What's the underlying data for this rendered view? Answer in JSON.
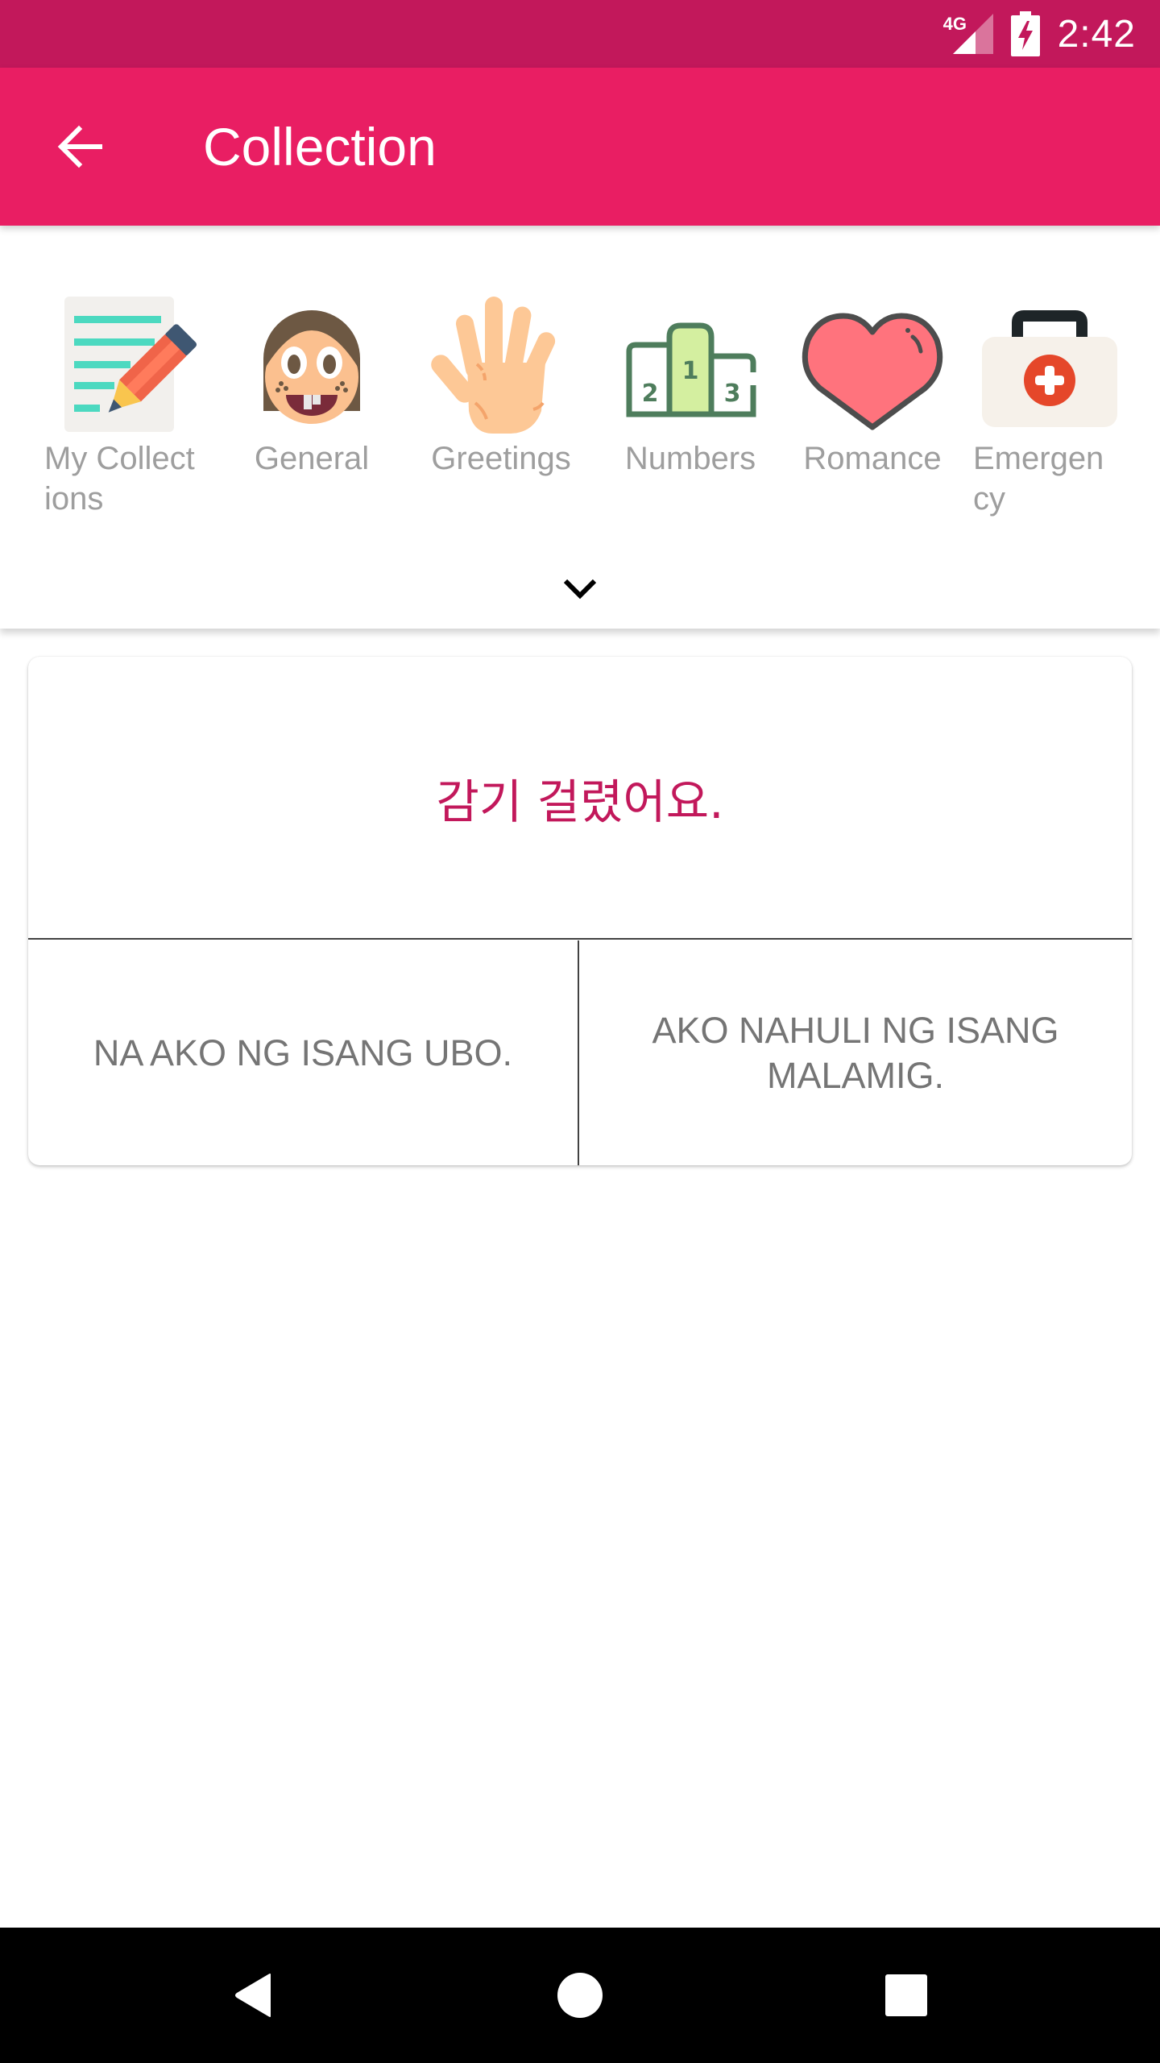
{
  "status_bar": {
    "network_label": "4G",
    "time": "2:42",
    "icons": [
      "signal-icon",
      "battery-charging-icon"
    ]
  },
  "app_bar": {
    "back_icon": "arrow-left-icon",
    "title": "Collection"
  },
  "categories": [
    {
      "label": "My Collections",
      "icon": "notebook-pencil-icon"
    },
    {
      "label": "General",
      "icon": "smiling-face-icon"
    },
    {
      "label": "Greetings",
      "icon": "waving-hand-icon"
    },
    {
      "label": "Numbers",
      "icon": "podium-icon"
    },
    {
      "label": "Romance",
      "icon": "heart-icon"
    },
    {
      "label": "Emergency",
      "icon": "first-aid-kit-icon"
    }
  ],
  "category_label_lines": {
    "my_collections": [
      "My Collect",
      "ions"
    ],
    "emergency": [
      "Emergen",
      "cy"
    ]
  },
  "expand_icon": "chevron-down-icon",
  "phrase_card": {
    "source_text": "감기 걸렸어요.",
    "options": [
      "NA AKO NG ISANG UBO.",
      "AKO NAHULI NG ISANG MALAMIG."
    ]
  },
  "colors": {
    "status_bar": "#C2185B",
    "app_bar": "#E91E63",
    "accent_text": "#C2185B",
    "option_text": "#757575",
    "category_label": "#9E9E9E"
  },
  "nav_bar": {
    "buttons": [
      "back-triangle-icon",
      "home-circle-icon",
      "recents-square-icon"
    ]
  }
}
